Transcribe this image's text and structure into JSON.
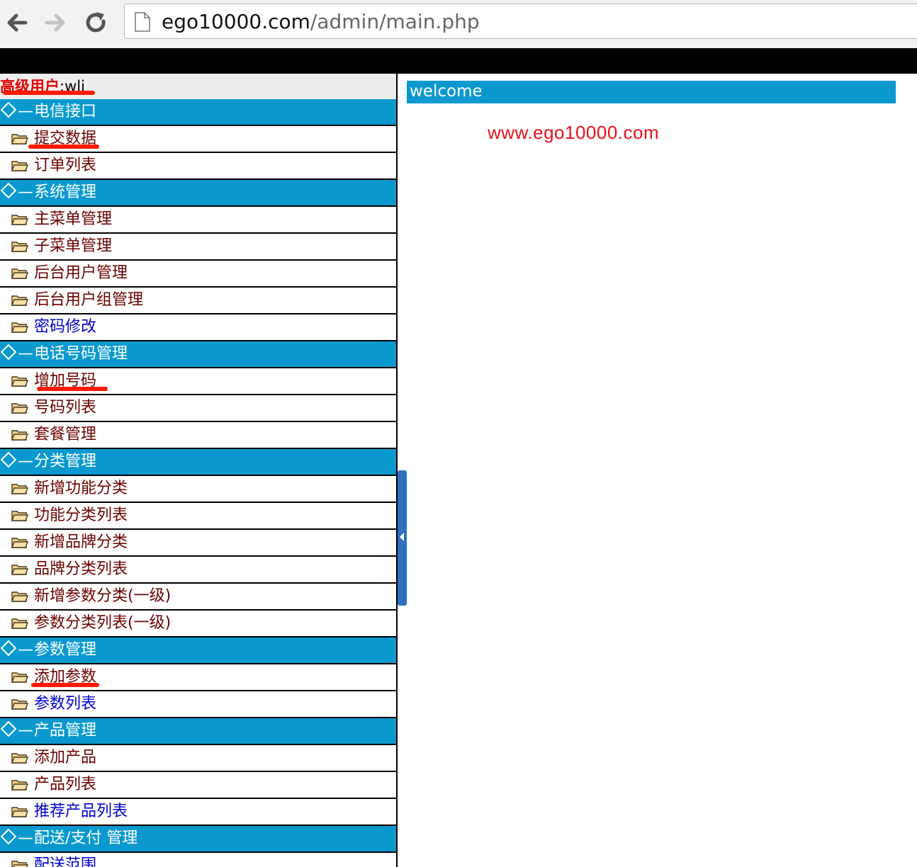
{
  "browser": {
    "url_host": "ego10000.com",
    "url_path": "/admin/main.php",
    "back_icon": "arrow-left-icon",
    "forward_icon": "arrow-right-icon",
    "reload_icon": "reload-icon"
  },
  "user": {
    "label": "高级用户",
    "separator": ":",
    "name": "wli"
  },
  "menu": {
    "groups": [
      {
        "title": "电信接口",
        "items": [
          {
            "label": "提交数据",
            "color": "#6b0000"
          },
          {
            "label": "订单列表",
            "color": "#6b0000"
          }
        ]
      },
      {
        "title": "系统管理",
        "items": [
          {
            "label": "主菜单管理",
            "color": "#6b0000"
          },
          {
            "label": "子菜单管理",
            "color": "#6b0000"
          },
          {
            "label": "后台用户管理",
            "color": "#6b0000"
          },
          {
            "label": "后台用户组管理",
            "color": "#6b0000"
          },
          {
            "label": "密码修改",
            "color": "#0000cc"
          }
        ]
      },
      {
        "title": "电话号码管理",
        "items": [
          {
            "label": "增加号码",
            "color": "#6b0000"
          },
          {
            "label": "号码列表",
            "color": "#6b0000"
          },
          {
            "label": "套餐管理",
            "color": "#6b0000"
          }
        ]
      },
      {
        "title": "分类管理",
        "items": [
          {
            "label": "新增功能分类",
            "color": "#6b0000"
          },
          {
            "label": "功能分类列表",
            "color": "#6b0000"
          },
          {
            "label": "新增品牌分类",
            "color": "#6b0000"
          },
          {
            "label": "品牌分类列表",
            "color": "#6b0000"
          },
          {
            "label": "新增参数分类(一级)",
            "color": "#6b0000"
          },
          {
            "label": "参数分类列表(一级)",
            "color": "#6b0000"
          }
        ]
      },
      {
        "title": "参数管理",
        "items": [
          {
            "label": "添加参数",
            "color": "#6b0000"
          },
          {
            "label": "参数列表",
            "color": "#0000cc"
          }
        ]
      },
      {
        "title": "产品管理",
        "items": [
          {
            "label": "添加产品",
            "color": "#6b0000"
          },
          {
            "label": "产品列表",
            "color": "#6b0000"
          },
          {
            "label": "推荐产品列表",
            "color": "#0000cc"
          }
        ]
      },
      {
        "title": "配送/支付 管理",
        "items": [
          {
            "label": "配送范围",
            "color": "#0000cc"
          }
        ]
      }
    ]
  },
  "main": {
    "welcome": "welcome",
    "site": "www.ego10000.com"
  },
  "colors": {
    "header_blue": "#0a99cf",
    "annotation_red": "#ff1a00",
    "link_red": "#e8101a"
  }
}
